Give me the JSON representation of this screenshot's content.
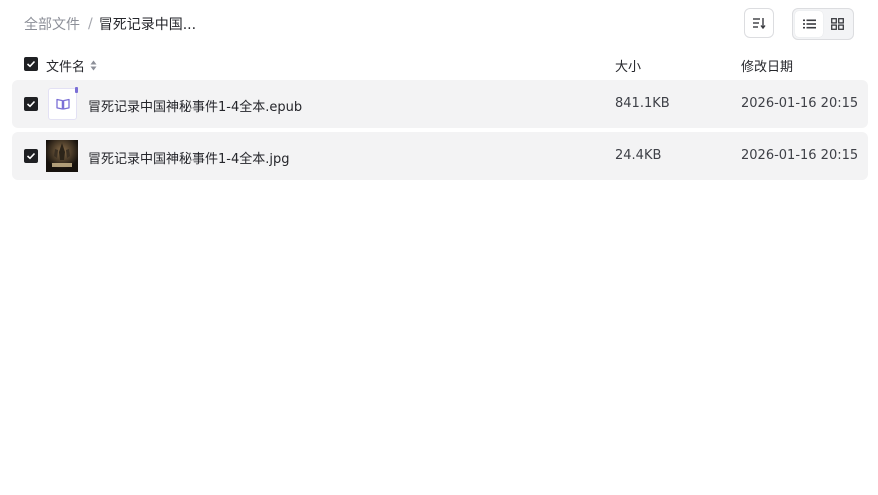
{
  "breadcrumb": {
    "root": "全部文件",
    "separator": "/",
    "current": "冒死记录中国..."
  },
  "toolbar": {
    "sort_icon": "sort-lines-icon",
    "view_list_icon": "list-view-icon",
    "view_grid_icon": "grid-view-icon",
    "active_view": "list"
  },
  "table": {
    "headers": {
      "name": "文件名",
      "size": "大小",
      "date": "修改日期"
    },
    "select_all_checked": true,
    "rows": [
      {
        "name": "冒死记录中国神秘事件1-4全本.epub",
        "size": "841.1KB",
        "date": "2026-01-16 20:15",
        "type_icon": "ebook-icon",
        "checked": true
      },
      {
        "name": "冒死记录中国神秘事件1-4全本.jpg",
        "size": "24.4KB",
        "date": "2026-01-16 20:15",
        "type_icon": "image-thumbnail",
        "checked": true
      }
    ]
  },
  "colors": {
    "accent": "#7b6fd6",
    "checkbox": "#1f2023",
    "row_bg": "#f3f3f4",
    "muted_text": "#8c8f98"
  }
}
